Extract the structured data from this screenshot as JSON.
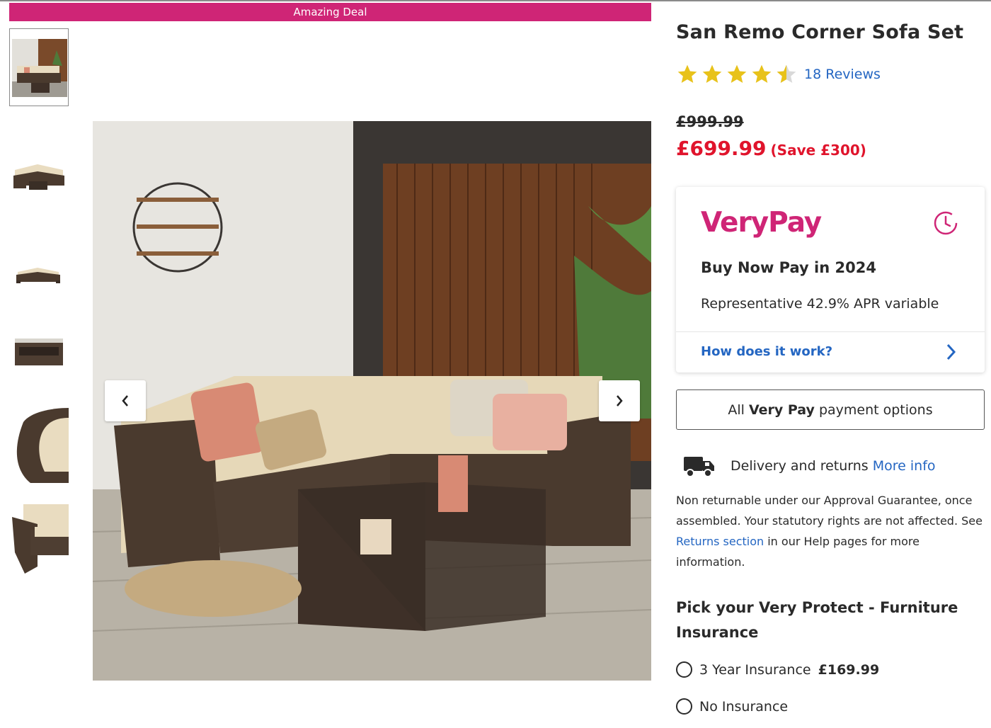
{
  "banner": {
    "label": "Amazing Deal"
  },
  "gallery": {
    "thumbnails": [
      {
        "name": "thumb-lifestyle"
      },
      {
        "name": "thumb-sofa-set"
      },
      {
        "name": "thumb-corner-sofa"
      },
      {
        "name": "thumb-coffee-table"
      },
      {
        "name": "thumb-arm-detail"
      },
      {
        "name": "thumb-chair"
      }
    ],
    "prev_icon": "chevron-left-icon",
    "next_icon": "chevron-right-icon"
  },
  "product": {
    "title": "San Remo Corner Sofa Set",
    "rating": 4.5,
    "rating_max": 5,
    "reviews_label": "18 Reviews",
    "was_price": "£999.99",
    "now_price": "£699.99",
    "save_label": "(Save £300)"
  },
  "verypay": {
    "logo": "VeryPay",
    "icon": "clock-icon",
    "heading": "Buy Now Pay in 2024",
    "apr": "Representative 42.9% APR variable",
    "how_label": "How does it work?"
  },
  "payment_options": {
    "prefix": "All",
    "bold": "Very Pay",
    "suffix": "payment options"
  },
  "delivery": {
    "icon": "truck-icon",
    "label": "Delivery and returns",
    "link": "More info",
    "text_1": "Non returnable under our Approval Guarantee, once assembled. Your statutory rights are not affected. See",
    "returns_link": "Returns section",
    "text_2": "in our Help pages for more information."
  },
  "protect": {
    "heading": "Pick your Very Protect - Furniture Insurance",
    "options": [
      {
        "label": "3 Year Insurance",
        "price": "£169.99"
      },
      {
        "label": "No Insurance",
        "price": ""
      }
    ]
  },
  "colors": {
    "brand_pink": "#cf2576",
    "link_blue": "#2466c2",
    "sale_red": "#e0142c",
    "star_gold": "#e8c21a"
  }
}
